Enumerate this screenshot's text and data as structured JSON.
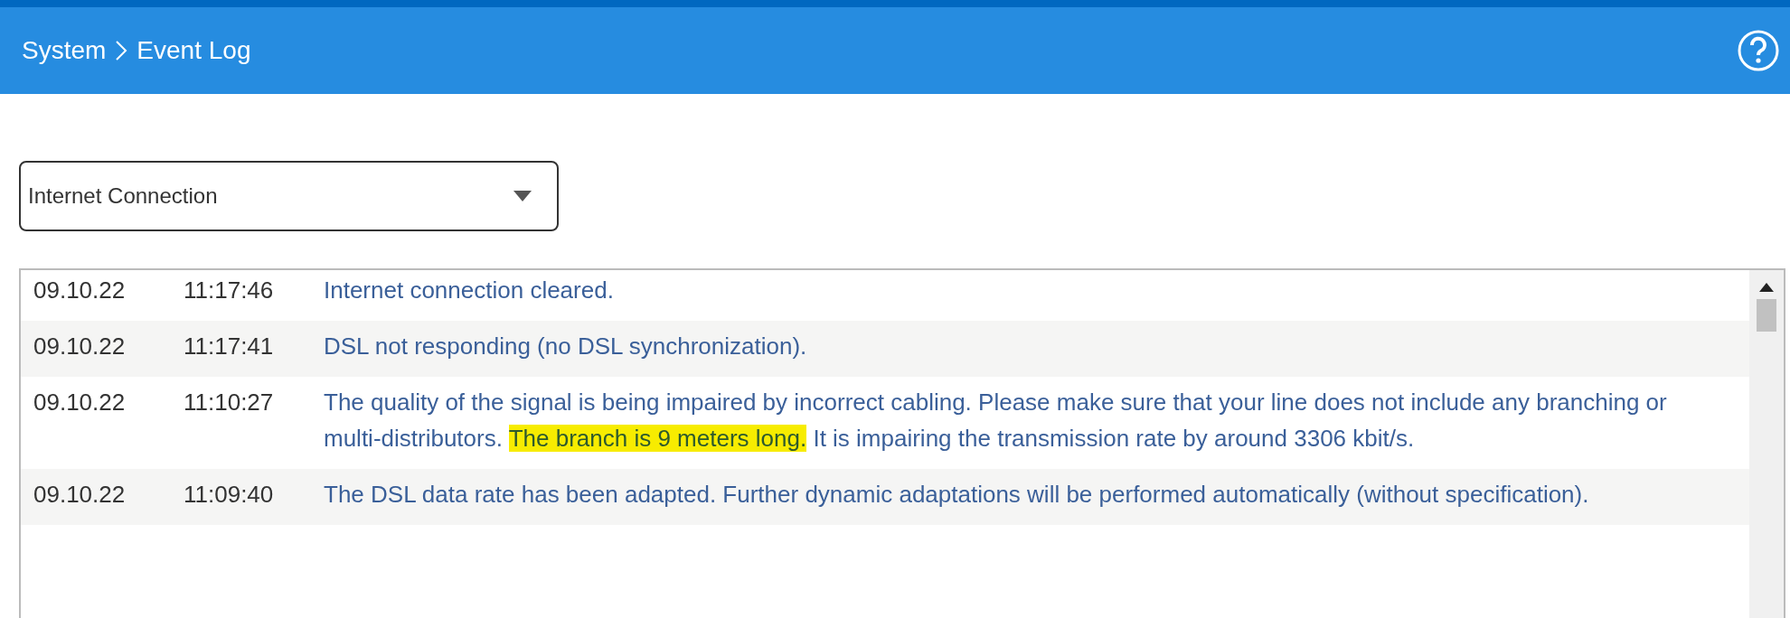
{
  "header": {
    "breadcrumb": [
      "System",
      "Event Log"
    ]
  },
  "filter": {
    "value": "Internet Connection"
  },
  "log": {
    "rows": [
      {
        "date": "09.10.22",
        "time": "11:17:46",
        "message": [
          {
            "text": "Internet connection cleared.",
            "highlighted": false
          }
        ]
      },
      {
        "date": "09.10.22",
        "time": "11:17:41",
        "message": [
          {
            "text": "DSL not responding (no DSL synchronization).",
            "highlighted": false
          }
        ]
      },
      {
        "date": "09.10.22",
        "time": "11:10:27",
        "message": [
          {
            "text": "The quality of the signal is being impaired by incorrect cabling. Please make sure that your line does not include any branching or multi-distributors. ",
            "highlighted": false
          },
          {
            "text": "The branch is 9 meters long.",
            "highlighted": true
          },
          {
            "text": " It is impairing the transmission rate by around 3306 kbit/s.",
            "highlighted": false
          }
        ]
      },
      {
        "date": "09.10.22",
        "time": "11:09:40",
        "message": [
          {
            "text": "The DSL data rate has been adapted. Further dynamic adaptations will be performed automatically (without specification).",
            "highlighted": false
          }
        ]
      }
    ]
  }
}
